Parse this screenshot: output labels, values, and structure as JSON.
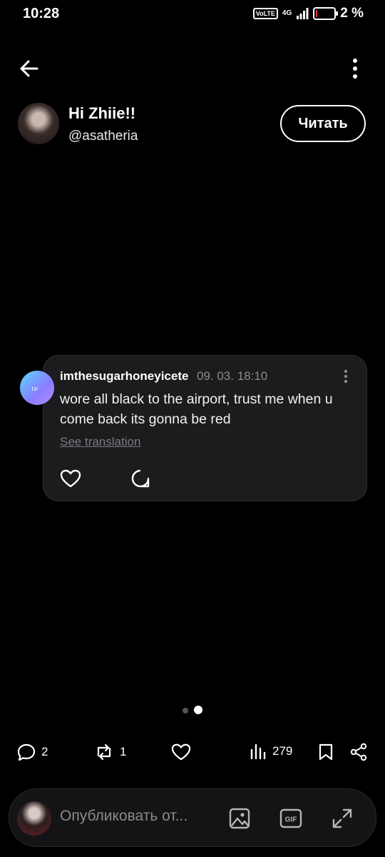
{
  "status_bar": {
    "time": "10:28",
    "volte": "VoLTE",
    "network": "4G",
    "battery": "2 %",
    "battery_level": 0.02
  },
  "post": {
    "author_name": "Hi Zhiie!!",
    "author_handle": "@asatheria",
    "follow_label": "Читать"
  },
  "comment": {
    "username": "imthesugarhoneyicete",
    "date": "09. 03. 18:10",
    "text": "wore all black to the airport, trust me when u come back its gonna be red",
    "translate_label": "See translation"
  },
  "pager": {
    "current": 2,
    "total": 2
  },
  "actions": {
    "replies": "2",
    "reposts": "1",
    "views": "279"
  },
  "compose": {
    "placeholder": "Опубликовать от..."
  },
  "icons": [
    "back-arrow-icon",
    "more-vertical-icon",
    "heart-icon",
    "comment-bubble-icon",
    "reply-icon",
    "repost-icon",
    "views-chart-icon",
    "bookmark-icon",
    "share-icon",
    "image-icon",
    "gif-icon",
    "expand-icon"
  ]
}
